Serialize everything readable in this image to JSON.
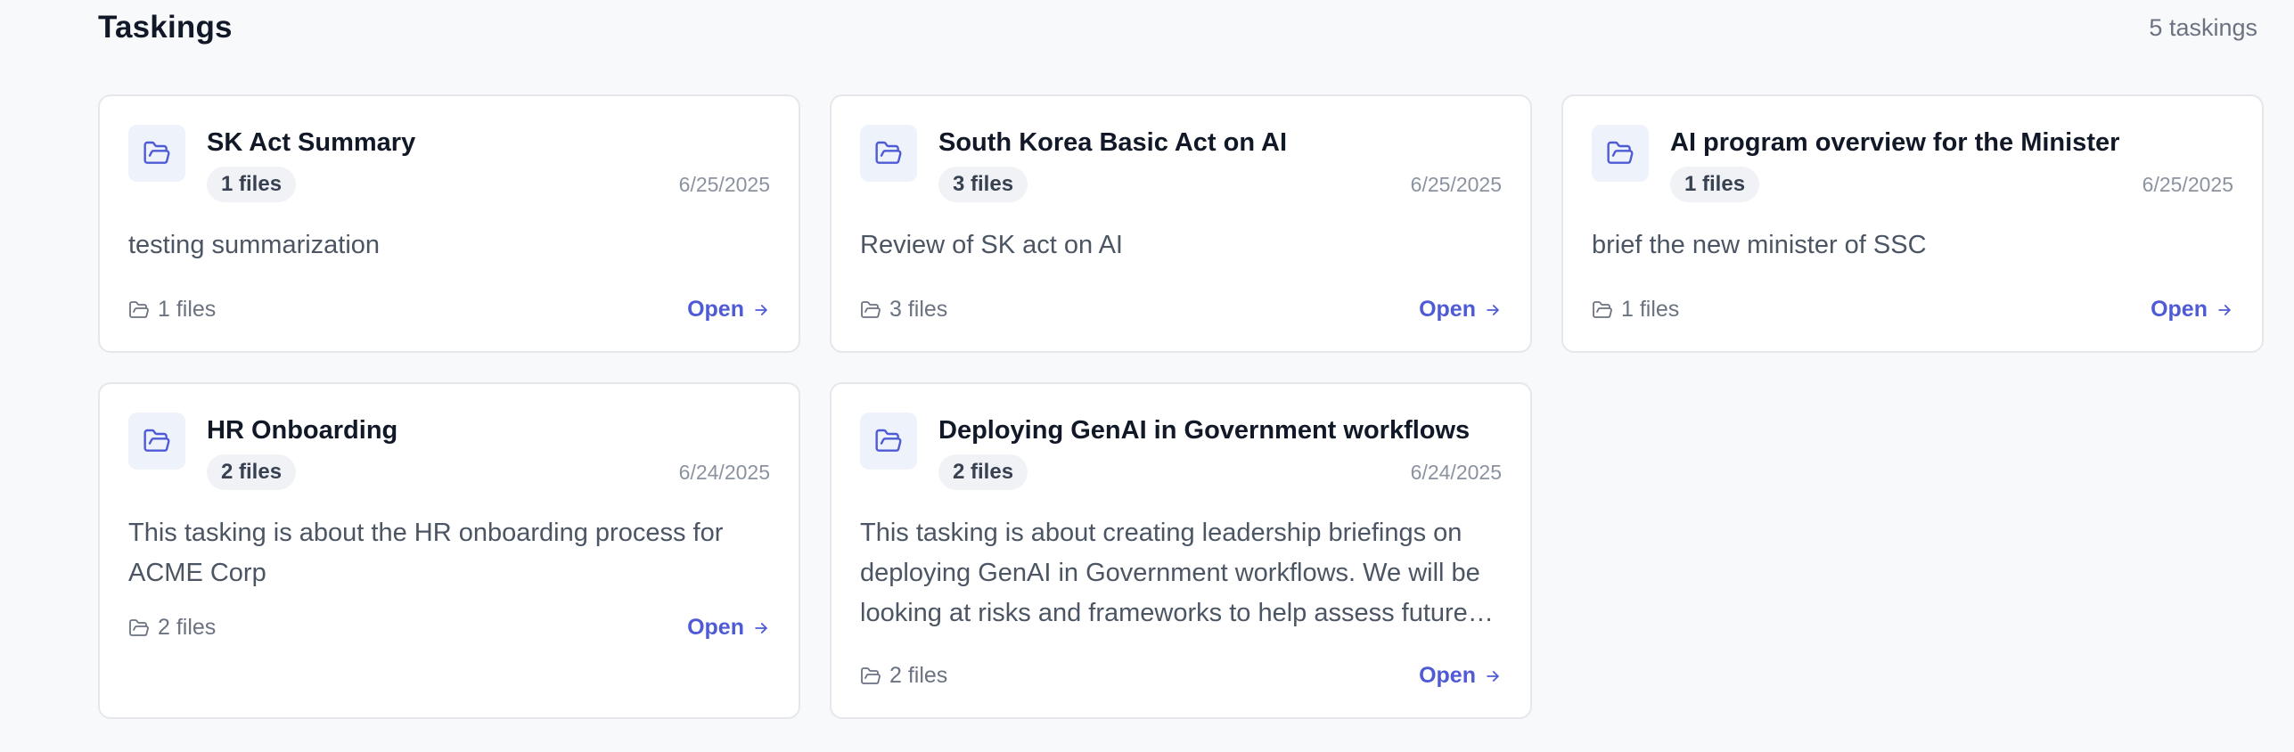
{
  "header": {
    "title": "Taskings",
    "count_label": "5 taskings"
  },
  "cards": [
    {
      "title": "SK Act Summary",
      "files_badge": "1 files",
      "date": "6/25/2025",
      "description": "testing summarization",
      "footer_files": "1 files",
      "open_label": "Open"
    },
    {
      "title": "South Korea Basic Act on AI",
      "files_badge": "3 files",
      "date": "6/25/2025",
      "description": "Review of SK act on AI",
      "footer_files": "3 files",
      "open_label": "Open"
    },
    {
      "title": "AI program overview for the Minister",
      "files_badge": "1 files",
      "date": "6/25/2025",
      "description": "brief the new minister of SSC",
      "footer_files": "1 files",
      "open_label": "Open"
    },
    {
      "title": "HR Onboarding",
      "files_badge": "2 files",
      "date": "6/24/2025",
      "description": "This tasking is about the HR onboarding process for ACME Corp",
      "footer_files": "2 files",
      "open_label": "Open"
    },
    {
      "title": "Deploying GenAI in Government workflows",
      "files_badge": "2 files",
      "date": "6/24/2025",
      "description": "This tasking is about creating leadership briefings on deploying GenAI in Government workflows. We will be looking at risks and frameworks to help assess future opportunities.",
      "footer_files": "2 files",
      "open_label": "Open"
    }
  ],
  "colors": {
    "accent": "#4f5bd5",
    "icon_bg": "#eef2fb",
    "page_bg": "#f8f9fb"
  },
  "icons": {
    "card_icon": "folder-open-icon",
    "footer_icon": "folder-icon",
    "open_icon": "arrow-right-icon"
  }
}
